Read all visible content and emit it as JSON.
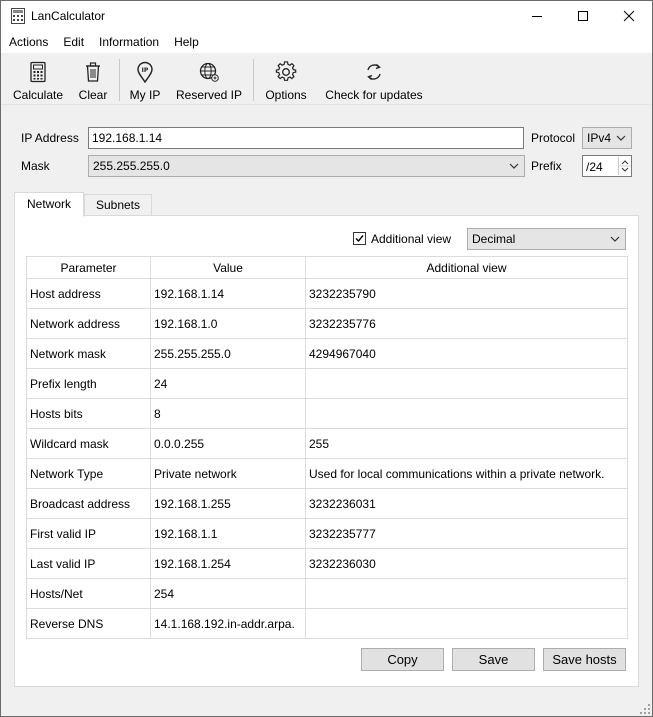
{
  "window": {
    "title": "LanCalculator",
    "controls": {
      "minimize": "—",
      "maximize": "☐",
      "close": "✕"
    }
  },
  "menubar": {
    "items": [
      "Actions",
      "Edit",
      "Information",
      "Help"
    ]
  },
  "toolbar": {
    "calculate_label": "Calculate",
    "clear_label": "Clear",
    "myip_label": "My IP",
    "reserved_label": "Reserved IP",
    "options_label": "Options",
    "updates_label": "Check for updates",
    "icons": [
      "calculator-icon",
      "trash-icon",
      "location-pin-icon",
      "globe-icon",
      "gear-icon",
      "refresh-icon"
    ]
  },
  "form": {
    "ip_label": "IP Address",
    "ip_value": "192.168.1.14",
    "protocol_label": "Protocol",
    "protocol_value": "IPv4",
    "mask_label": "Mask",
    "mask_value": "255.255.255.0",
    "prefix_label": "Prefix",
    "prefix_value": "/24"
  },
  "tabs": {
    "network": "Network",
    "subnets": "Subnets"
  },
  "view": {
    "additional_label": "Additional view",
    "additional_checked": true,
    "format_value": "Decimal"
  },
  "table": {
    "headers": [
      "Parameter",
      "Value",
      "Additional view"
    ],
    "rows": [
      [
        "Host address",
        "192.168.1.14",
        "3232235790"
      ],
      [
        "Network address",
        "192.168.1.0",
        "3232235776"
      ],
      [
        "Network mask",
        "255.255.255.0",
        "4294967040"
      ],
      [
        "Prefix length",
        "24",
        ""
      ],
      [
        "Hosts bits",
        "8",
        ""
      ],
      [
        "Wildcard mask",
        "0.0.0.255",
        "255"
      ],
      [
        "Network Type",
        "Private network",
        "Used for local communications within a private network."
      ],
      [
        "Broadcast address",
        "192.168.1.255",
        "3232236031"
      ],
      [
        "First valid IP",
        "192.168.1.1",
        "3232235777"
      ],
      [
        "Last valid IP",
        "192.168.1.254",
        "3232236030"
      ],
      [
        "Hosts/Net",
        "254",
        ""
      ],
      [
        "Reverse DNS",
        "14.1.168.192.in-addr.arpa.",
        ""
      ]
    ]
  },
  "buttons": {
    "copy": "Copy",
    "save": "Save",
    "save_hosts": "Save hosts"
  },
  "colors": {
    "window_bg": "#f0f0f0",
    "panel_bg": "#ffffff",
    "border": "#828282"
  }
}
